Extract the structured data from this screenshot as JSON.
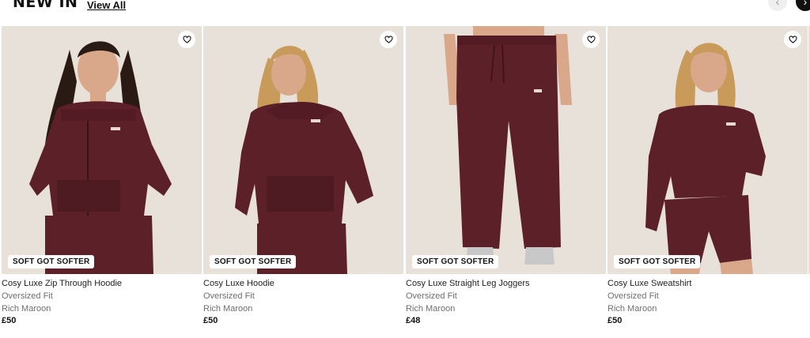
{
  "section": {
    "title": "NEW IN",
    "view_all": "View All",
    "prev_icon": "chevron-left-icon",
    "next_icon": "chevron-right-icon"
  },
  "colors": {
    "garment": "#5b2028",
    "background": "#e7e1da",
    "skin": "#d9a88a",
    "hair_dark": "#2a1a14",
    "hair_blonde": "#c99b5a"
  },
  "products": [
    {
      "badge": "SOFT GOT SOFTER",
      "name": "Cosy Luxe Zip Through Hoodie",
      "fit": "Oversized Fit",
      "colour": "Rich Maroon",
      "price": "£50"
    },
    {
      "badge": "SOFT GOT SOFTER",
      "name": "Cosy Luxe Hoodie",
      "fit": "Oversized Fit",
      "colour": "Rich Maroon",
      "price": "£50"
    },
    {
      "badge": "SOFT GOT SOFTER",
      "name": "Cosy Luxe Straight Leg Joggers",
      "fit": "Oversized Fit",
      "colour": "Rich Maroon",
      "price": "£48"
    },
    {
      "badge": "SOFT GOT SOFTER",
      "name": "Cosy Luxe Sweatshirt",
      "fit": "Oversized Fit",
      "colour": "Rich Maroon",
      "price": "£50"
    }
  ]
}
